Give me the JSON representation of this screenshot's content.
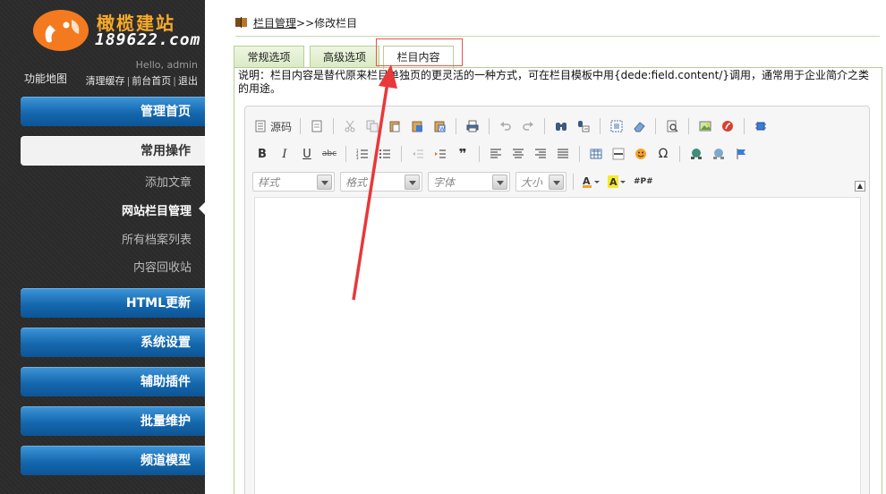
{
  "sidebar": {
    "logo_brand": "橄榄建站",
    "logo_domain": "189622.com",
    "hello": "Hello, admin",
    "sitemap": "功能地图",
    "top_links": [
      "清理缓存",
      "前台首页",
      "退出"
    ],
    "sections": [
      {
        "label": "管理首页"
      },
      {
        "label": "常用操作"
      },
      {
        "label": "HTML更新"
      },
      {
        "label": "系统设置"
      },
      {
        "label": "辅助插件"
      },
      {
        "label": "批量维护"
      },
      {
        "label": "频道模型"
      }
    ],
    "sub_items": [
      "添加文章",
      "网站栏目管理",
      "所有档案列表",
      "内容回收站"
    ],
    "current_sub": "网站栏目管理"
  },
  "breadcrumb": {
    "link": "栏目管理",
    "separator": ">>",
    "current": "修改栏目"
  },
  "tabs": [
    {
      "label": "常规选项"
    },
    {
      "label": "高级选项"
    },
    {
      "label": "栏目内容"
    }
  ],
  "active_tab": "栏目内容",
  "description": "说明：栏目内容是替代原来栏目单独页的更灵活的一种方式，可在栏目模板中用{dede:field.content/}调用，通常用于企业简介之类的用途。",
  "editor": {
    "source_label": "源码",
    "combos": [
      {
        "placeholder": "样式"
      },
      {
        "placeholder": "格式"
      },
      {
        "placeholder": "字体"
      },
      {
        "placeholder": "大小"
      }
    ],
    "content": ""
  },
  "colors": {
    "sidebar_bg": "#2b2b2b",
    "nav_blue": "#1467ad",
    "tab_border": "#b6cf93",
    "highlight_red": "#e8544c"
  }
}
